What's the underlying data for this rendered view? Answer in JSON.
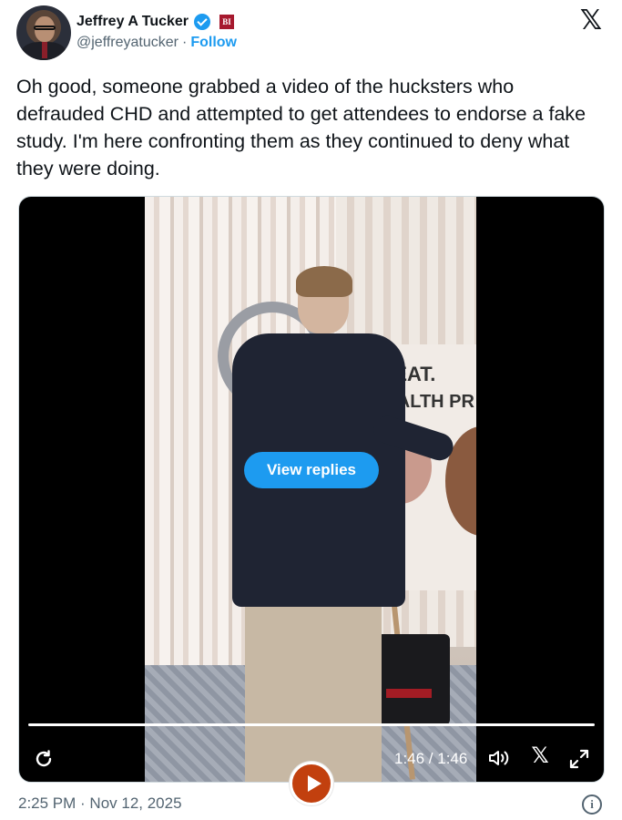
{
  "author": {
    "name": "Jeffrey A Tucker",
    "handle": "@jeffreyatucker",
    "separator": "·",
    "follow_label": "Follow",
    "affiliate_badge": "BI"
  },
  "platform_logo": "𝕏",
  "tweet": {
    "text": "Oh good, someone grabbed a video of the hucksters who defrauded CHD and attempted to get attendees to endorse a fake study. I'm here confronting them as they continued to deny what they were doing."
  },
  "video": {
    "view_replies_label": "View replies",
    "time_display": "1:46 / 1:46",
    "poster_line1": "MEAT.",
    "poster_line2": "HEALTH PR",
    "x_logo": "𝕏",
    "progress": 1.0
  },
  "footer": {
    "timestamp": "2:25 PM · Nov 12, 2025",
    "info_glyph": "i"
  },
  "colors": {
    "accent": "#1d9bf0",
    "text": "#0f1419",
    "muted": "#536471",
    "play_button": "#c2400e"
  },
  "icons": {
    "verified": "verified-badge-icon",
    "replay": "replay-icon",
    "volume": "volume-icon",
    "expand": "expand-icon",
    "play": "play-icon",
    "info": "info-icon"
  }
}
